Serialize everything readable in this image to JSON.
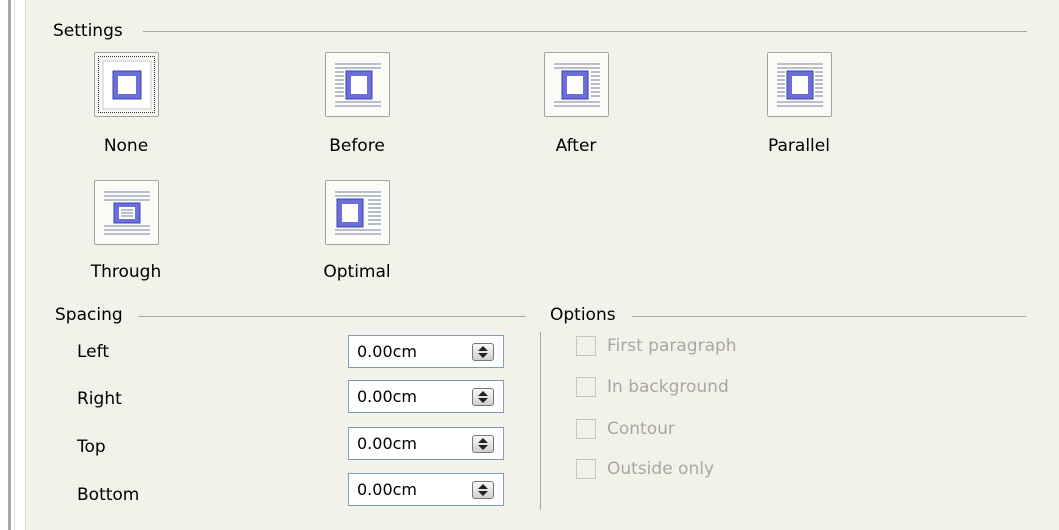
{
  "settings": {
    "title": "Settings",
    "options": [
      {
        "label": "None"
      },
      {
        "label": "Before"
      },
      {
        "label": "After"
      },
      {
        "label": "Parallel"
      },
      {
        "label": "Through"
      },
      {
        "label": "Optimal"
      }
    ],
    "selected": "None"
  },
  "spacing": {
    "title": "Spacing",
    "fields": [
      {
        "label": "Left",
        "value": "0.00cm"
      },
      {
        "label": "Right",
        "value": "0.00cm"
      },
      {
        "label": "Top",
        "value": "0.00cm"
      },
      {
        "label": "Bottom",
        "value": "0.00cm"
      }
    ]
  },
  "options": {
    "title": "Options",
    "items": [
      {
        "label": "First paragraph",
        "checked": false,
        "enabled": false
      },
      {
        "label": "In background",
        "checked": false,
        "enabled": false
      },
      {
        "label": "Contour",
        "checked": false,
        "enabled": false
      },
      {
        "label": "Outside only",
        "checked": false,
        "enabled": false
      }
    ]
  },
  "colors": {
    "accent": "#4a5cf0",
    "icon_lines": "#8f9bb5"
  }
}
